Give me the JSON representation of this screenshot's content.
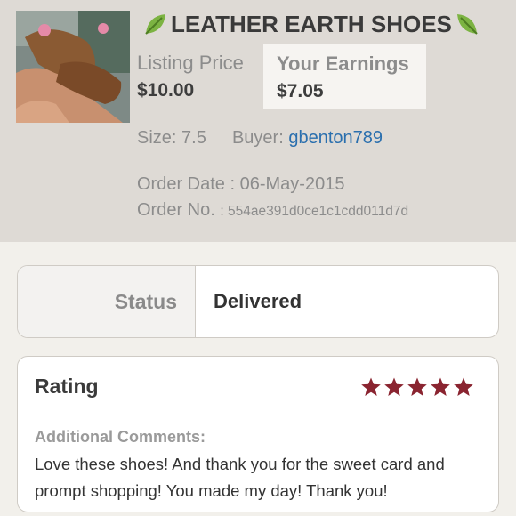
{
  "item": {
    "title": "LEATHER EARTH SHOES",
    "listing_price_label": "Listing Price",
    "listing_price": "$10.00",
    "earnings_label": "Your Earnings",
    "earnings": "$7.05",
    "size_label": "Size:",
    "size": "7.5",
    "buyer_label": "Buyer:",
    "buyer": "gbenton789",
    "order_date_label": "Order Date :",
    "order_date": "06-May-2015",
    "order_no_label": "Order No.",
    "order_no": ": 554ae391d0ce1c1cdd011d7d"
  },
  "status": {
    "label": "Status",
    "value": "Delivered"
  },
  "rating": {
    "label": "Rating",
    "stars": 5,
    "max_stars": 5,
    "star_color": "#8a2430",
    "comments_label": "Additional Comments:",
    "comments": "Love these shoes! And thank you for the sweet card and prompt shopping! You made my day! Thank you!"
  },
  "icons": {
    "title_left": "leaf-icon",
    "title_right": "leaf-icon",
    "rating": "star-icon"
  },
  "colors": {
    "link": "#2a6fae",
    "header_bg": "#dedad5"
  }
}
